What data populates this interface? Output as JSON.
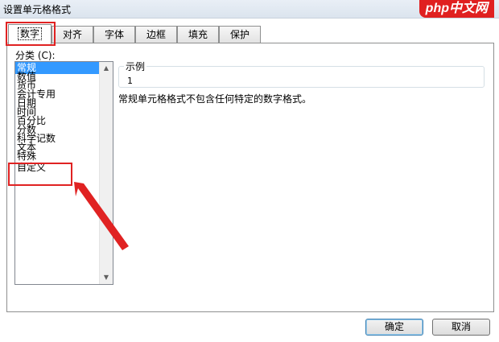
{
  "window": {
    "title": "设置单元格格式",
    "logo_text": "php中文网"
  },
  "tabs": [
    {
      "label": "数字",
      "active": true
    },
    {
      "label": "对齐",
      "active": false
    },
    {
      "label": "字体",
      "active": false
    },
    {
      "label": "边框",
      "active": false
    },
    {
      "label": "填充",
      "active": false
    },
    {
      "label": "保护",
      "active": false
    }
  ],
  "category": {
    "label": "分类 (C):",
    "items": [
      "常规",
      "数值",
      "货币",
      "会计专用",
      "日期",
      "时间",
      "百分比",
      "分数",
      "科学记数",
      "文本",
      "特殊",
      "自定义"
    ],
    "selected_index": 0
  },
  "sample": {
    "legend": "示例",
    "value": "1"
  },
  "description": "常规单元格格式不包含任何特定的数字格式。",
  "buttons": {
    "ok": "确定",
    "cancel": "取消"
  },
  "colors": {
    "annotation": "#e02222",
    "selection": "#3399ff"
  }
}
